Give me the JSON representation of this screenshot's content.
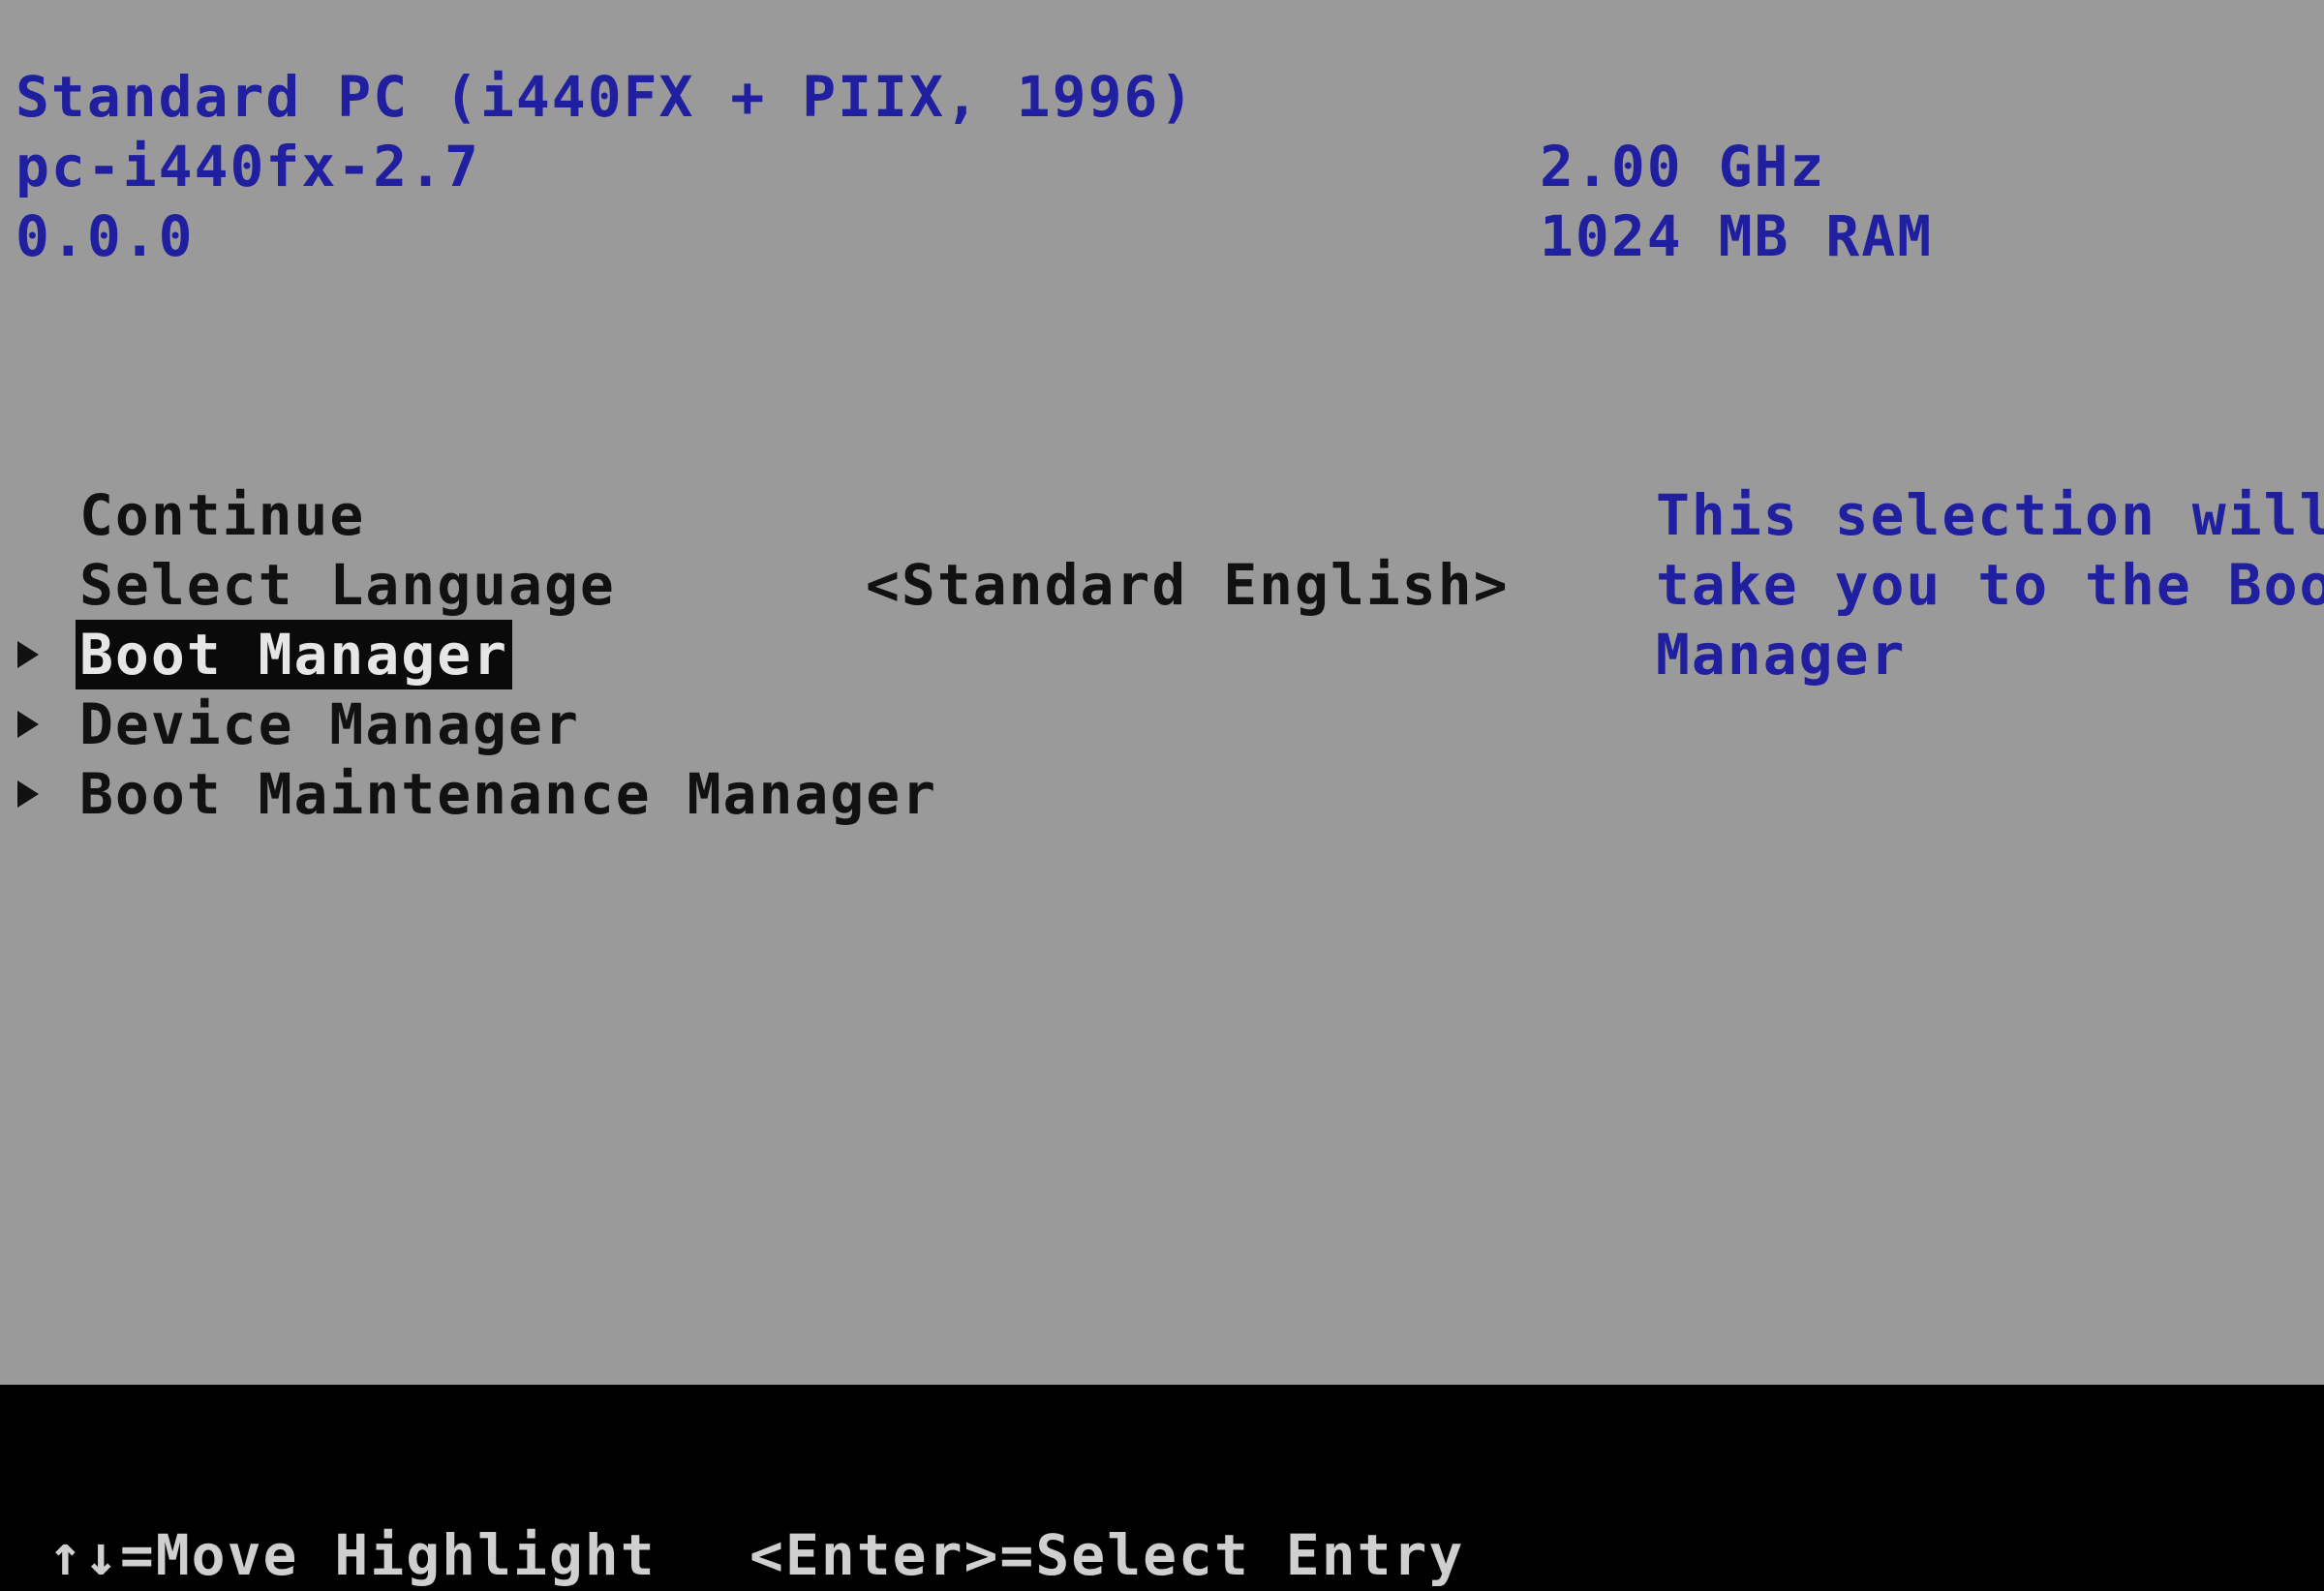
{
  "header": {
    "model": "Standard PC (i440FX + PIIX, 1996)",
    "version": "pc-i440fx-2.7",
    "firmware": "0.0.0",
    "cpu_speed": "2.00 GHz",
    "memory": "1024 MB RAM"
  },
  "menu": {
    "continue": "Continue",
    "select_language": "Select Language",
    "language_value": "<Standard English>",
    "boot_manager": "Boot Manager",
    "device_manager": "Device Manager",
    "boot_maintenance_manager": "Boot Maintenance Manager",
    "selected": "Boot Manager"
  },
  "help": {
    "line1": "This selection will",
    "line2": "take you to the Boot",
    "line3": "Manager"
  },
  "footer": {
    "move_hint": "↑↓=Move Highlight",
    "enter_hint": "<Enter>=Select Entry"
  },
  "colors": {
    "background": "#9a9a9a",
    "info_text": "#1f1fa0",
    "menu_text": "#111111",
    "highlight_bg": "#0a0a0a",
    "footer_bg": "#000000"
  }
}
